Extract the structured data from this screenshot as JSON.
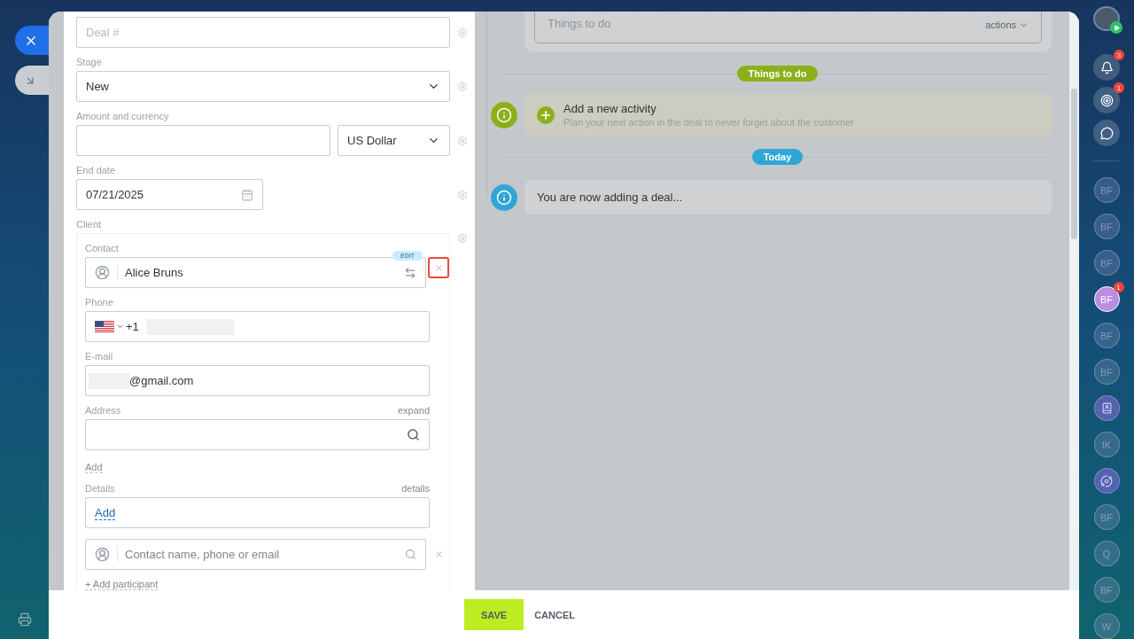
{
  "form": {
    "deal_number": {
      "placeholder": "Deal #"
    },
    "stage": {
      "label": "Stage",
      "value": "New"
    },
    "amount": {
      "label": "Amount and currency",
      "currency": "US Dollar"
    },
    "end_date": {
      "label": "End date",
      "value": "07/21/2025"
    },
    "client": {
      "label": "Client",
      "contact_label": "Contact",
      "contact_name": "Alice Bruns",
      "edit_badge": "EDIT",
      "remove_highlighted": true,
      "phone": {
        "label": "Phone",
        "code": "+1"
      },
      "email": {
        "label": "E-mail",
        "value": "@gmail.com"
      },
      "address": {
        "label": "Address",
        "expand": "expand",
        "add": "Add"
      },
      "details": {
        "label": "Details",
        "link": "details",
        "add": "Add"
      },
      "search": {
        "placeholder": "Contact name, phone or email"
      },
      "add_participant": "+ Add participant"
    }
  },
  "timeline": {
    "composer": {
      "placeholder": "Things to do",
      "actions": "actions"
    },
    "entries": [
      {
        "kind": "divider",
        "label": "Things to do",
        "color": "#8db01a"
      },
      {
        "kind": "activity",
        "title": "Add a new activity",
        "subtitle": "Plan your next action in the deal to never forget about the customer",
        "color": "#8db01a"
      },
      {
        "kind": "divider",
        "label": "Today",
        "color": "#2fa6d6"
      },
      {
        "kind": "event",
        "text": "You are now adding a deal...",
        "color": "#2fa6d6"
      }
    ]
  },
  "footer": {
    "buttons": [
      {
        "kind": "primary",
        "label": "SAVE"
      },
      {
        "kind": "plain",
        "label": "CANCEL"
      }
    ]
  },
  "sidebar": {
    "tools": [
      {
        "kind": "bell",
        "badge": "3"
      },
      {
        "kind": "target",
        "badge": "1"
      },
      {
        "kind": "chat"
      }
    ],
    "chats": [
      {
        "kind": "initials",
        "label": "BF",
        "selected": false
      },
      {
        "kind": "initials",
        "label": "BF",
        "selected": false
      },
      {
        "kind": "initials",
        "label": "BF",
        "selected": false
      },
      {
        "kind": "initials",
        "label": "BF",
        "selected": true,
        "badge": "1"
      },
      {
        "kind": "initials",
        "label": "BF",
        "selected": false
      },
      {
        "kind": "initials",
        "label": "BF",
        "selected": false
      },
      {
        "kind": "book",
        "selected": false
      },
      {
        "kind": "initials",
        "label": "IK",
        "selected": false
      },
      {
        "kind": "swirl",
        "selected": false
      },
      {
        "kind": "initials",
        "label": "BF",
        "selected": false
      },
      {
        "kind": "initials",
        "label": "Q",
        "selected": false
      },
      {
        "kind": "initials",
        "label": "BF",
        "selected": false
      },
      {
        "kind": "initials",
        "label": "W",
        "selected": false
      }
    ]
  }
}
